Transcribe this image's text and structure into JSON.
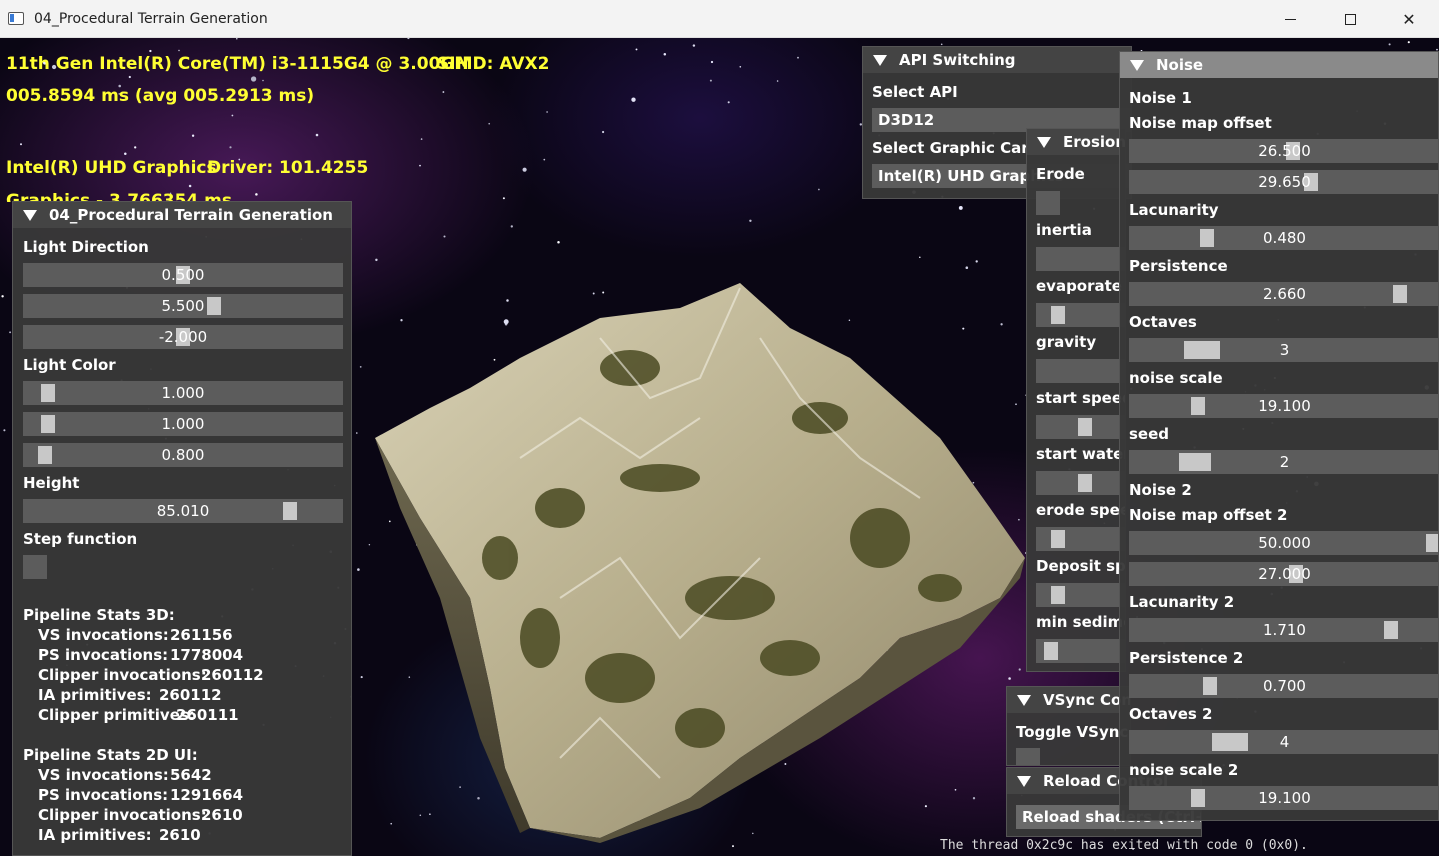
{
  "window": {
    "title": "04_Procedural Terrain Generation"
  },
  "hud": {
    "cpu": "11th Gen Intel(R) Core(TM) i3-1115G4 @ 3.00GH",
    "simd": "SIMD: AVX2",
    "frame_time": "005.8594 ms (avg 005.2913 ms)",
    "gpu": "Intel(R) UHD Graphics",
    "driver": "Driver: 101.4255",
    "graphics": "Graphics - 3.766354 ms"
  },
  "main_panel": {
    "title": "04_Procedural Terrain Generation",
    "light_direction": {
      "label": "Light Direction",
      "values": [
        "0.500",
        "5.500",
        "-2.000"
      ],
      "fractions": [
        0.5,
        0.6,
        0.5
      ]
    },
    "light_color": {
      "label": "Light Color",
      "values": [
        "1.000",
        "1.000",
        "0.800"
      ],
      "fractions": [
        0.06,
        0.06,
        0.05
      ]
    },
    "height": {
      "label": "Height",
      "value": "85.010",
      "fraction": 0.85
    },
    "step_function": {
      "label": "Step function"
    },
    "stats3d": {
      "title": "Pipeline Stats 3D:",
      "rows": [
        {
          "label": "VS invocations:",
          "value": "261156"
        },
        {
          "label": "PS invocations:",
          "value": "1778004"
        },
        {
          "label": "Clipper invocations:",
          "value": "260112"
        },
        {
          "label": "IA primitives:",
          "value": "260112"
        },
        {
          "label": "Clipper primitives:",
          "value": "260111"
        }
      ]
    },
    "stats2d": {
      "title": "Pipeline Stats 2D UI:",
      "rows": [
        {
          "label": "VS invocations:",
          "value": "5642"
        },
        {
          "label": "PS invocations:",
          "value": "1291664"
        },
        {
          "label": "Clipper invocations:",
          "value": "2610"
        },
        {
          "label": "IA primitives:",
          "value": "2610"
        }
      ]
    }
  },
  "api_panel": {
    "title": "API Switching",
    "select_api_label": "Select API",
    "api_value": "D3D12",
    "select_card_label": "Select Graphic Card",
    "card_value": "Intel(R) UHD Graphics"
  },
  "erosion_panel": {
    "title": "Erosion",
    "items": [
      "Erode",
      "inertia",
      "evaporate",
      "gravity",
      "start speed",
      "start water",
      "erode speed",
      "Deposit speed",
      "min sediment"
    ]
  },
  "vsync_panel": {
    "title": "VSync Control",
    "toggle_label": "Toggle VSync"
  },
  "reload_panel": {
    "title": "Reload Control",
    "button_label": "Reload shaders (Ctrl+S)"
  },
  "noise_panel": {
    "title": "Noise",
    "noise1": "Noise 1",
    "offset_label": "Noise map offset",
    "offset_values": [
      "26.500",
      "29.650"
    ],
    "offset_fractions": [
      0.53,
      0.59
    ],
    "lacunarity": {
      "label": "Lacunarity",
      "value": "0.480",
      "fraction": 0.24
    },
    "persistence": {
      "label": "Persistence",
      "value": "2.660",
      "fraction": 0.89
    },
    "octaves": {
      "label": "Octaves",
      "value": "3",
      "fraction": 0.2
    },
    "noise_scale": {
      "label": "noise scale",
      "value": "19.100",
      "fraction": 0.21
    },
    "seed": {
      "label": "seed",
      "value": "2",
      "fraction": 0.18
    },
    "noise2": "Noise 2",
    "offset2_label": "Noise map offset 2",
    "offset2_values": [
      "50.000",
      "27.000"
    ],
    "offset2_fractions": [
      1.0,
      0.54
    ],
    "lacunarity2": {
      "label": "Lacunarity 2",
      "value": "1.710",
      "fraction": 0.86
    },
    "persistence2": {
      "label": "Persistence 2",
      "value": "0.700",
      "fraction": 0.25
    },
    "octaves2": {
      "label": "Octaves 2",
      "value": "4",
      "fraction": 0.3
    },
    "noise_scale2": {
      "label": "noise scale 2",
      "value": "19.100",
      "fraction": 0.21
    }
  },
  "console_text": "The thread 0x2c9c has exited with code 0 (0x0)."
}
